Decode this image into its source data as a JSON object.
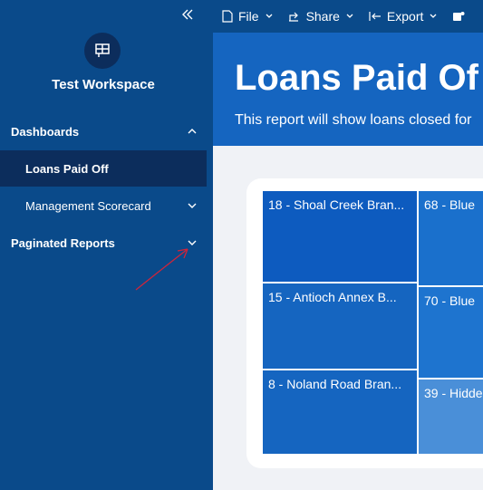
{
  "sidebar": {
    "workspace_name": "Test Workspace",
    "sections": [
      {
        "label": "Dashboards"
      },
      {
        "label": "Loans Paid Off"
      },
      {
        "label": "Management Scorecard"
      },
      {
        "label": "Paginated Reports"
      }
    ]
  },
  "toolbar": {
    "file_label": "File",
    "share_label": "Share",
    "export_label": "Export"
  },
  "report": {
    "title": "Loans Paid Of",
    "subtitle": "This report will show loans closed for"
  },
  "treemap": {
    "tiles": [
      {
        "label": "18 - Shoal Creek Bran...",
        "color": "#0d5bbf"
      },
      {
        "label": "15 - Antioch Annex B...",
        "color": "#1565c0"
      },
      {
        "label": "8 - Noland Road Bran...",
        "color": "#1565c0"
      },
      {
        "label": "68 - Blue",
        "color": "#1a70cc"
      },
      {
        "label": "70 - Blue",
        "color": "#1e74cf"
      },
      {
        "label": "39 - Hidde",
        "color": "#4a8fd8"
      }
    ]
  },
  "colors": {
    "sidebar_bg": "#0a4a8a",
    "active_item_bg": "#0c2d5c",
    "banner_bg": "#1565c0",
    "annotation_arrow": "#d0243a"
  }
}
